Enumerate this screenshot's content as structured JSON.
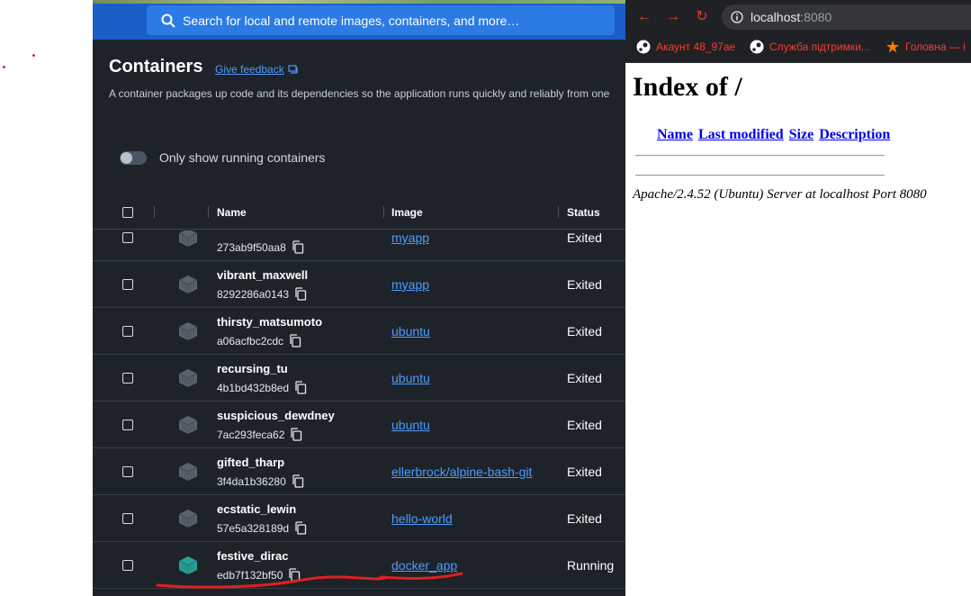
{
  "docker": {
    "search_placeholder": "Search for local and remote images, containers, and more…",
    "page_title": "Containers",
    "feedback_label": "Give feedback",
    "description": "A container packages up code and its dependencies so the application runs quickly and reliably from one",
    "toggle_label": "Only show running containers",
    "toggle_on": false,
    "columns": {
      "name": "Name",
      "image": "Image",
      "status": "Status"
    },
    "rows": [
      {
        "name": "",
        "id": "273ab9f50aa8",
        "image": "myapp",
        "status": "Exited",
        "running": false
      },
      {
        "name": "vibrant_maxwell",
        "id": "8292286a0143",
        "image": "myapp",
        "status": "Exited",
        "running": false
      },
      {
        "name": "thirsty_matsumoto",
        "id": "a06acfbc2cdc",
        "image": "ubuntu",
        "status": "Exited",
        "running": false
      },
      {
        "name": "recursing_tu",
        "id": "4b1bd432b8ed",
        "image": "ubuntu",
        "status": "Exited",
        "running": false
      },
      {
        "name": "suspicious_dewdney",
        "id": "7ac293feca62",
        "image": "ubuntu",
        "status": "Exited",
        "running": false
      },
      {
        "name": "gifted_tharp",
        "id": "3f4da1b36280",
        "image": "ellerbrock/alpine-bash-git",
        "status": "Exited",
        "running": false
      },
      {
        "name": "ecstatic_lewin",
        "id": "57e5a328189d",
        "image": "hello-world",
        "status": "Exited",
        "running": false
      },
      {
        "name": "festive_dirac",
        "id": "edb7f132bf50",
        "image": "docker_app",
        "status": "Running",
        "running": true
      }
    ],
    "colors": {
      "background": "#1d2329",
      "link": "#4f9cff",
      "running_icon": "#2aa198",
      "stopped_icon": "#59636d",
      "annotation": "#e02020"
    }
  },
  "browser": {
    "url_host": "localhost",
    "url_port": ":8080",
    "bookmarks": [
      {
        "label": "Акаунт 48_97ae",
        "icon": "steam-icon"
      },
      {
        "label": "Служба підтримки...",
        "icon": "steam-icon"
      },
      {
        "label": "Головна — і",
        "icon": "star-icon"
      }
    ],
    "index_title": "Index of /",
    "columns": [
      "Name",
      "Last modified",
      "Size",
      "Description"
    ],
    "footer": "Apache/2.4.52 (Ubuntu) Server at localhost Port 8080"
  }
}
